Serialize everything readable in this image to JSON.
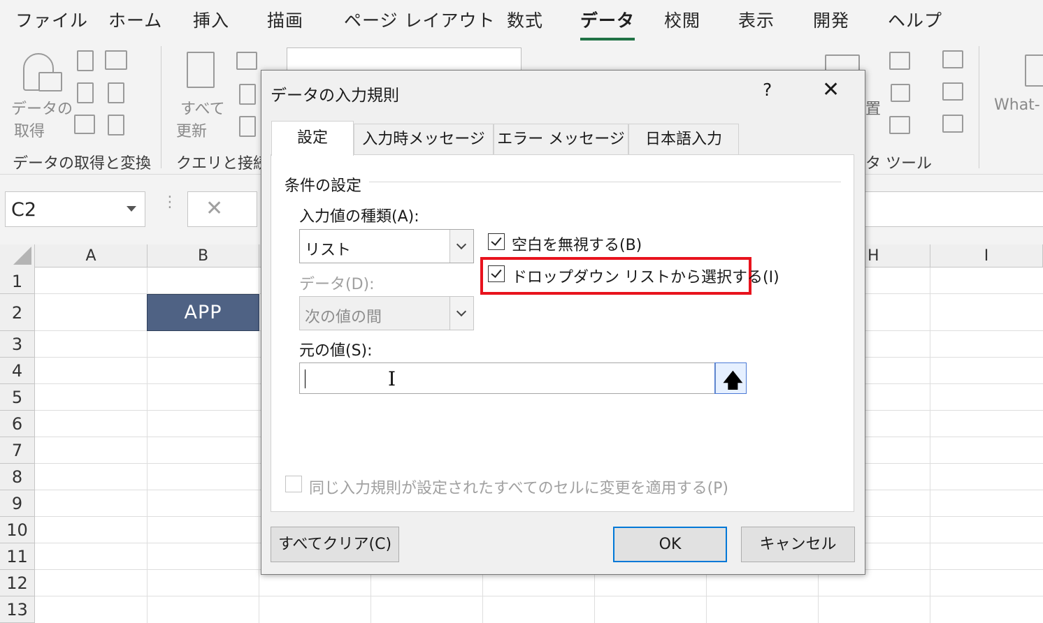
{
  "ribbon": {
    "tabs": [
      "ファイル",
      "ホーム",
      "挿入",
      "描画",
      "ページ レイアウト",
      "数式",
      "データ",
      "校閲",
      "表示",
      "開発",
      "ヘルプ"
    ],
    "active_tab": "データ",
    "groups": {
      "get_data": {
        "label_line1": "データの",
        "label_line2": "取得",
        "name": "データの取得と変換"
      },
      "refresh": {
        "label_line1": "すべて",
        "label_line2": "更新",
        "name": "クエリと接続"
      },
      "data_tools": {
        "partial_text": "置",
        "name": "タ ツール"
      },
      "forecast": {
        "what_if": "What-"
      }
    }
  },
  "formula_bar": {
    "name_box": "C2",
    "cancel_glyph": "✕",
    "dots": "⋮"
  },
  "grid": {
    "columns": [
      "A",
      "B",
      "H",
      "I"
    ],
    "rows": [
      "1",
      "2",
      "3",
      "4",
      "5",
      "6",
      "7",
      "8",
      "9",
      "10",
      "11",
      "12",
      "13"
    ],
    "cell_b2": "APP"
  },
  "dialog": {
    "title": "データの入力規則",
    "help": "?",
    "close": "✕",
    "tabs": [
      "設定",
      "入力時メッセージ",
      "エラー メッセージ",
      "日本語入力"
    ],
    "active_tab": "設定",
    "criteria_label": "条件の設定",
    "allow_label": "入力値の種類(A):",
    "allow_value": "リスト",
    "data_label": "データ(D):",
    "data_value": "次の値の間",
    "ignore_blank_label": "空白を無視する(B)",
    "ignore_blank_checked": true,
    "dropdown_label": "ドロップダウン リストから選択する(I)",
    "dropdown_checked": true,
    "source_label": "元の値(S):",
    "source_value": "",
    "apply_all_label": "同じ入力規則が設定されたすべてのセルに変更を適用する(P)",
    "apply_all_checked": false,
    "clear_all": "すべてクリア(C)",
    "ok": "OK",
    "cancel": "キャンセル",
    "collapse_arrow": "🡅",
    "ibeam": "I"
  },
  "colors": {
    "accent_green": "#217346",
    "cell_fill": "#4f6284",
    "highlight_red": "#e8131d",
    "default_button_border": "#0078d7"
  }
}
